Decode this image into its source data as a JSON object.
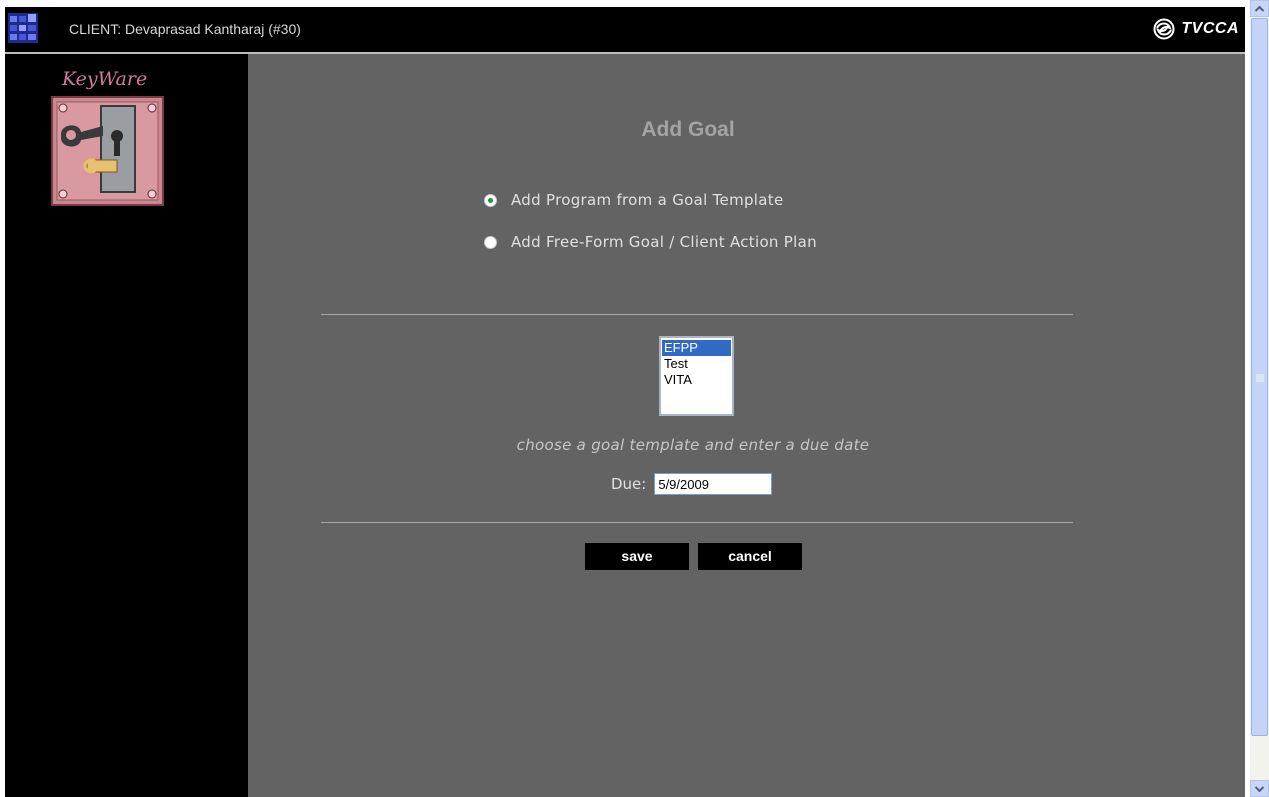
{
  "titlebar": {
    "client_label": "CLIENT: Devaprasad Kantharaj (#30)",
    "brand": "TVCCA",
    "app_icon": "app-grid-icon",
    "brand_icon": "tvcca-swirl-icon"
  },
  "sidebar": {
    "logo_text": "KeyWare",
    "logo_icon": "keyhole-logo-icon"
  },
  "main": {
    "title": "Add Goal",
    "options": [
      {
        "label": "Add Program from a Goal Template",
        "checked": true
      },
      {
        "label": "Add Free-Form Goal / Client Action Plan",
        "checked": false
      }
    ],
    "templates": [
      "EFPP",
      "Test",
      "VITA"
    ],
    "selected_template": "EFPP",
    "hint": "choose a goal template and enter a due date",
    "due_label": "Due:",
    "due_value": "5/9/2009",
    "save_label": "save",
    "cancel_label": "cancel"
  },
  "colors": {
    "panel_bg": "#636363",
    "sidebar_bg": "#000000",
    "title_color": "#a4a4a4",
    "selection": "#316ac5",
    "radio_dot": "#1a9a3a"
  }
}
